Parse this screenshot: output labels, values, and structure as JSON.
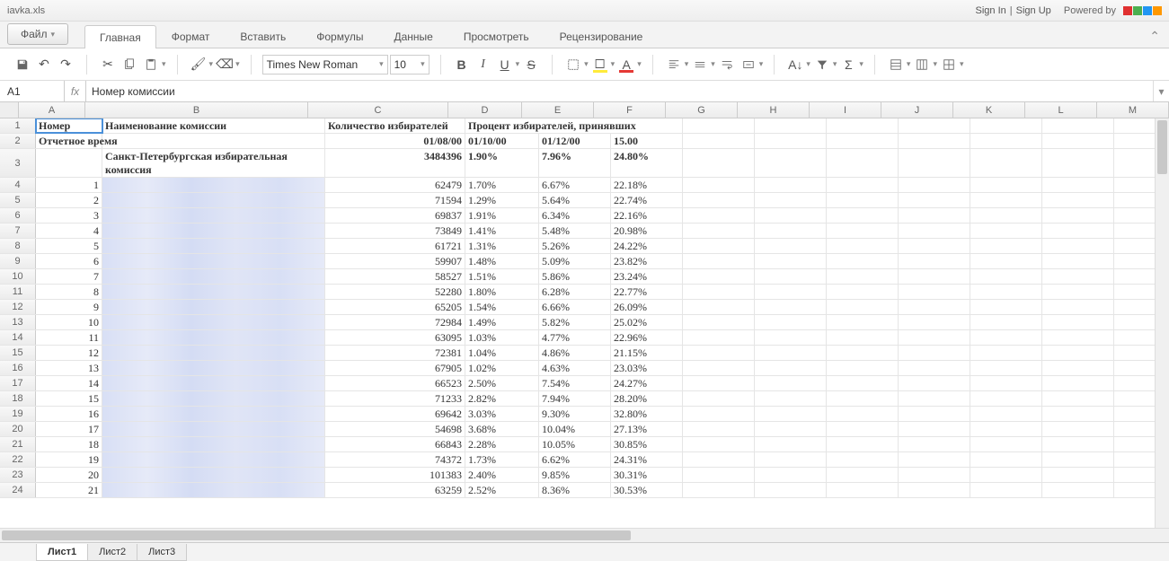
{
  "titlebar": {
    "filename": "iavka.xls",
    "sign_in": "Sign In",
    "sign_up": "Sign Up",
    "powered_by": "Powered by"
  },
  "menu": {
    "file": "Файл",
    "tabs": [
      "Главная",
      "Формат",
      "Вставить",
      "Формулы",
      "Данные",
      "Просмотреть",
      "Рецензирование"
    ],
    "active_index": 0
  },
  "toolbar": {
    "font_name": "Times New Roman",
    "font_size": "10"
  },
  "formula_bar": {
    "cell_ref": "A1",
    "fx": "fx",
    "content": "Номер комиссии"
  },
  "columns": [
    "A",
    "B",
    "C",
    "D",
    "E",
    "F",
    "G",
    "H",
    "I",
    "J",
    "K",
    "L",
    "M"
  ],
  "header_row": {
    "A": "Номер",
    "B": "Наименование комиссии",
    "C": "Количество избирателей",
    "D": "Процент избирателей, принявших"
  },
  "row2": {
    "A": "Отчетное время",
    "C": "01/08/00",
    "D": "01/10/00",
    "E": "01/12/00",
    "F": "15.00"
  },
  "row3": {
    "B": "Санкт-Петербургская избирательная комиссия",
    "C": "3484396",
    "D": "1.90%",
    "E": "7.96%",
    "F": "24.80%"
  },
  "data_rows": [
    {
      "n": "1",
      "c": "62479",
      "d": "1.70%",
      "e": "6.67%",
      "f": "22.18%"
    },
    {
      "n": "2",
      "c": "71594",
      "d": "1.29%",
      "e": "5.64%",
      "f": "22.74%"
    },
    {
      "n": "3",
      "c": "69837",
      "d": "1.91%",
      "e": "6.34%",
      "f": "22.16%"
    },
    {
      "n": "4",
      "c": "73849",
      "d": "1.41%",
      "e": "5.48%",
      "f": "20.98%"
    },
    {
      "n": "5",
      "c": "61721",
      "d": "1.31%",
      "e": "5.26%",
      "f": "24.22%"
    },
    {
      "n": "6",
      "c": "59907",
      "d": "1.48%",
      "e": "5.09%",
      "f": "23.82%"
    },
    {
      "n": "7",
      "c": "58527",
      "d": "1.51%",
      "e": "5.86%",
      "f": "23.24%"
    },
    {
      "n": "8",
      "c": "52280",
      "d": "1.80%",
      "e": "6.28%",
      "f": "22.77%"
    },
    {
      "n": "9",
      "c": "65205",
      "d": "1.54%",
      "e": "6.66%",
      "f": "26.09%"
    },
    {
      "n": "10",
      "c": "72984",
      "d": "1.49%",
      "e": "5.82%",
      "f": "25.02%"
    },
    {
      "n": "11",
      "c": "63095",
      "d": "1.03%",
      "e": "4.77%",
      "f": "22.96%"
    },
    {
      "n": "12",
      "c": "72381",
      "d": "1.04%",
      "e": "4.86%",
      "f": "21.15%"
    },
    {
      "n": "13",
      "c": "67905",
      "d": "1.02%",
      "e": "4.63%",
      "f": "23.03%"
    },
    {
      "n": "14",
      "c": "66523",
      "d": "2.50%",
      "e": "7.54%",
      "f": "24.27%"
    },
    {
      "n": "15",
      "c": "71233",
      "d": "2.82%",
      "e": "7.94%",
      "f": "28.20%"
    },
    {
      "n": "16",
      "c": "69642",
      "d": "3.03%",
      "e": "9.30%",
      "f": "32.80%"
    },
    {
      "n": "17",
      "c": "54698",
      "d": "3.68%",
      "e": "10.04%",
      "f": "27.13%"
    },
    {
      "n": "18",
      "c": "66843",
      "d": "2.28%",
      "e": "10.05%",
      "f": "30.85%"
    },
    {
      "n": "19",
      "c": "74372",
      "d": "1.73%",
      "e": "6.62%",
      "f": "24.31%"
    },
    {
      "n": "20",
      "c": "101383",
      "d": "2.40%",
      "e": "9.85%",
      "f": "30.31%"
    },
    {
      "n": "21",
      "c": "63259",
      "d": "2.52%",
      "e": "8.36%",
      "f": "30.53%"
    }
  ],
  "sheets": [
    "Лист1",
    "Лист2",
    "Лист3"
  ],
  "active_sheet": 0
}
